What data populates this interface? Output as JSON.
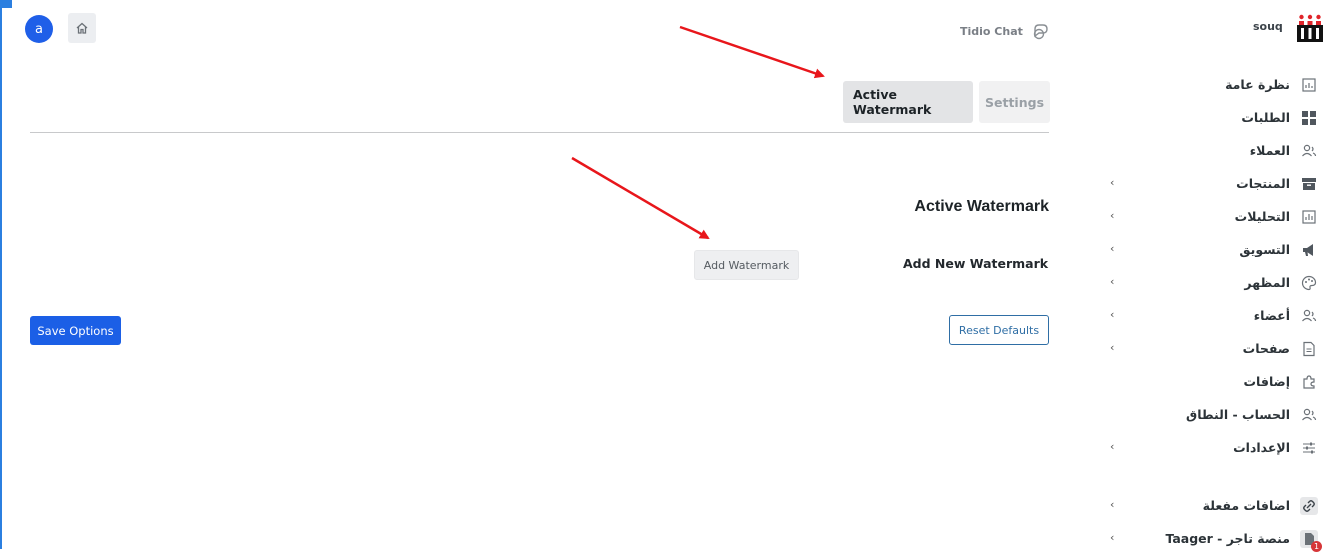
{
  "topbar": {
    "avatar_letter": "a",
    "tidio_label": "Tidio Chat"
  },
  "tabs": [
    {
      "label": "Active Watermark",
      "active": true
    },
    {
      "label": "Settings",
      "active": false
    }
  ],
  "main": {
    "section_title": "Active Watermark",
    "field_label": "Add New Watermark",
    "add_button": "Add Watermark",
    "save_button": "Save Options",
    "reset_button": "Reset Defaults"
  },
  "sidebar": {
    "brand": "souq",
    "items": [
      {
        "label": "نظرة عامة",
        "icon": "overview-icon",
        "chevron": false
      },
      {
        "label": "الطلبات",
        "icon": "orders-icon",
        "chevron": false
      },
      {
        "label": "العملاء",
        "icon": "customers-icon",
        "chevron": false
      },
      {
        "label": "المنتجات",
        "icon": "products-icon",
        "chevron": true
      },
      {
        "label": "التحليلات",
        "icon": "analytics-icon",
        "chevron": true
      },
      {
        "label": "التسويق",
        "icon": "marketing-icon",
        "chevron": true
      },
      {
        "label": "المظهر",
        "icon": "appearance-icon",
        "chevron": true
      },
      {
        "label": "أعضاء",
        "icon": "members-icon",
        "chevron": true
      },
      {
        "label": "صفحات",
        "icon": "pages-icon",
        "chevron": true
      },
      {
        "label": "إضافات",
        "icon": "plugins-icon",
        "chevron": false
      },
      {
        "label": "الحساب - النطاق",
        "icon": "account-icon",
        "chevron": false
      },
      {
        "label": "الإعدادات",
        "icon": "settings-icon",
        "chevron": true
      },
      {
        "label": "اضافات مفعلة",
        "icon": "link-icon",
        "chevron": true
      },
      {
        "label": "Taager - منصة تاجر",
        "icon": "taager-icon",
        "chevron": true,
        "badge": "1"
      }
    ]
  },
  "colors": {
    "primary": "#1b5fe6",
    "arrow": "#e8161b",
    "reset_border": "#2f6ea5"
  }
}
